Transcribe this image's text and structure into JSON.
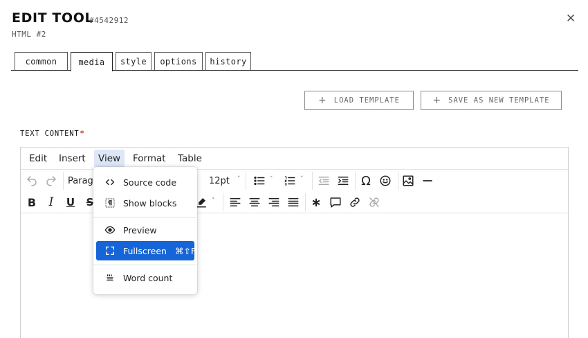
{
  "header": {
    "title": "EDIT TOOL",
    "ticket": "#4542912",
    "subtitle": "HTML #2",
    "close_icon": "close-icon"
  },
  "tabs": [
    {
      "label": "common",
      "active": false
    },
    {
      "label": "media",
      "active": true
    },
    {
      "label": "style",
      "active": false
    },
    {
      "label": "options",
      "active": false
    },
    {
      "label": "history",
      "active": false
    }
  ],
  "template_buttons": {
    "load": "LOAD TEMPLATE",
    "save": "SAVE AS NEW TEMPLATE",
    "plus": "+"
  },
  "field": {
    "label": "TEXT CONTENT",
    "required_mark": "*"
  },
  "editor": {
    "menubar": [
      {
        "label": "Edit",
        "active": false
      },
      {
        "label": "Insert",
        "active": false
      },
      {
        "label": "View",
        "active": true
      },
      {
        "label": "Format",
        "active": false
      },
      {
        "label": "Table",
        "active": false
      }
    ],
    "toolbar": {
      "block_format": "Parag",
      "font_size": "12pt"
    },
    "view_menu": {
      "items": [
        {
          "label": "Source code",
          "icon": "source-code-icon"
        },
        {
          "label": "Show blocks",
          "icon": "show-blocks-icon"
        },
        {
          "label": "Preview",
          "icon": "preview-icon"
        },
        {
          "label": "Fullscreen",
          "icon": "fullscreen-icon",
          "shortcut": "⌘⇧F",
          "highlighted": true
        },
        {
          "label": "Word count",
          "icon": "word-count-icon"
        }
      ]
    },
    "content": ""
  },
  "colors": {
    "accent": "#1565d8",
    "menu_active_bg": "#dde7f5",
    "required": "#c0392b"
  }
}
